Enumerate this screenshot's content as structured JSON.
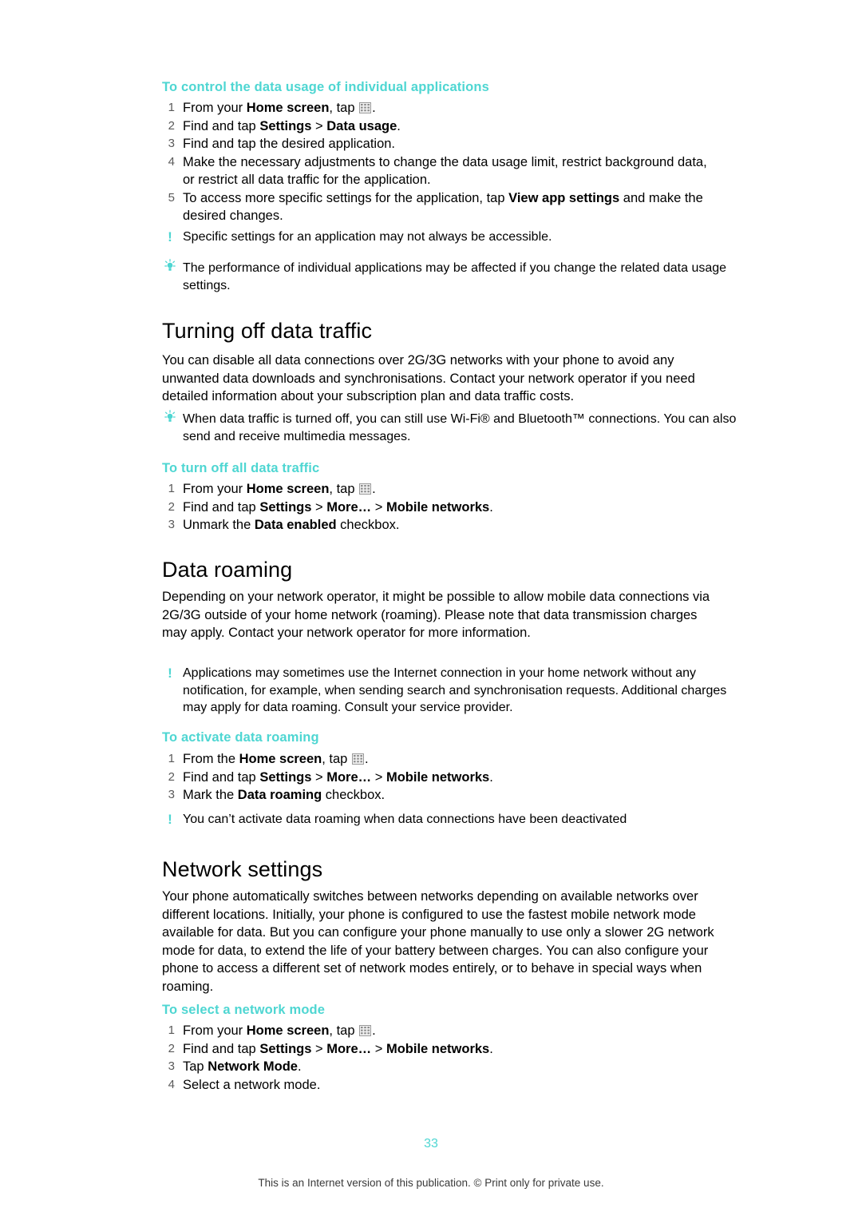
{
  "page": {
    "number": "33",
    "footer": "This is an Internet version of this publication. © Print only for private use.",
    "accent_color": "#4ed6d2"
  },
  "proc1": {
    "title": "To control the data usage of individual applications",
    "steps": [
      {
        "num": "1",
        "text_pre": "From your ",
        "bold": "Home screen",
        "text_post": ", tap ",
        "icon": "keypad-icon",
        "text_end": "."
      },
      {
        "num": "2",
        "html": "Find and tap <b>Settings</b> > <b>Data usage</b>."
      },
      {
        "num": "3",
        "html": "Find and tap the desired application."
      },
      {
        "num": "4",
        "html": "Make the necessary adjustments to change the data usage limit, restrict background data, or restrict all data traffic for the application."
      },
      {
        "num": "5",
        "html": "To access more specific settings for the application, tap <b>View app settings</b> and make the desired changes."
      }
    ],
    "note": "Specific settings for an application may not always be accessible.",
    "tip": "The performance of individual applications may be affected if you change the related data usage settings."
  },
  "section_turning_off": {
    "title": "Turning off data traffic",
    "body": "You can disable all data connections over 2G/3G networks with your phone to avoid any unwanted data downloads and synchronisations. Contact your network operator if you need detailed information about your subscription plan and data traffic costs.",
    "tip": "When data traffic is turned off, you can still use Wi-Fi® and Bluetooth™ connections. You can also send and receive multimedia messages.",
    "proc": {
      "title": "To turn off all data traffic",
      "steps": [
        {
          "num": "1",
          "html": "From your <b>Home screen</b>, tap "
        },
        {
          "num": "2",
          "html": "Find and tap <b>Settings</b> > <b>More…</b> > <b>Mobile networks</b>."
        },
        {
          "num": "3",
          "html": "Unmark the <b>Data enabled</b> checkbox."
        }
      ]
    }
  },
  "section_roaming": {
    "title": "Data roaming",
    "body": "Depending on your network operator, it might be possible to allow mobile data connections via 2G/3G outside of your home network (roaming). Please note that data transmission charges may apply. Contact your network operator for more information.",
    "note": "Applications may sometimes use the Internet connection in your home network without any notification, for example, when sending search and synchronisation requests. Additional charges may apply for data roaming. Consult your service provider.",
    "proc": {
      "title": "To activate data roaming",
      "steps": [
        {
          "num": "1",
          "html": "From the <b>Home screen</b>, tap "
        },
        {
          "num": "2",
          "html": "Find and tap <b>Settings</b> > <b>More…</b> > <b>Mobile networks</b>."
        },
        {
          "num": "3",
          "html": "Mark the <b>Data roaming</b> checkbox."
        }
      ],
      "note": "You can’t activate data roaming when data connections have been deactivated"
    }
  },
  "section_network": {
    "title": "Network settings",
    "body": "Your phone automatically switches between networks depending on available networks over different locations. Initially, your phone is configured to use the fastest mobile network mode available for data. But you can configure your phone manually to use only a slower 2G network mode for data, to extend the life of your battery between charges. You can also configure your phone to access a different set of network modes entirely, or to behave in special ways when roaming.",
    "proc": {
      "title": "To select a network mode",
      "steps": [
        {
          "num": "1",
          "html": "From your <b>Home screen</b>, tap "
        },
        {
          "num": "2",
          "html": "Find and tap <b>Settings</b> > <b>More…</b> > <b>Mobile networks</b>."
        },
        {
          "num": "3",
          "html": "Tap <b>Network Mode</b>."
        },
        {
          "num": "4",
          "html": "Select a network mode."
        }
      ]
    }
  }
}
